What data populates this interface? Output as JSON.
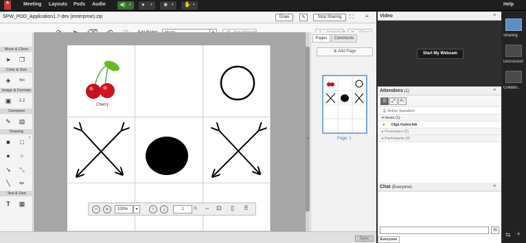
{
  "menubar": {
    "items": [
      "Meeting",
      "Layouts",
      "Pods",
      "Audio"
    ],
    "help": "Help"
  },
  "share": {
    "title": "SPW_POD_Application1.7-dev (enterprise).zip",
    "draw_label": "Draw",
    "stop_sharing_label": "Stop Sharing",
    "edit_rights_label": "Edit Rights:",
    "edit_rights_value": "Hosts",
    "not_allowed_label": "Not Allowed",
    "download_label": "Download",
    "close_label": "Close",
    "sections": [
      "Move & Clone",
      "Color & Size",
      "Image & Formats",
      "Comment",
      "Drawing",
      "Text & Grid"
    ],
    "size_label": "4px",
    "cherry_label": "Cherry",
    "zoom_value": "100%",
    "page_number": "1",
    "page_total": "/1",
    "sync_label": "Sync"
  },
  "pages_panel": {
    "tabs": [
      "Pages",
      "Comments"
    ],
    "add_page_label": "Add Page",
    "page_label": "Page: 1"
  },
  "video": {
    "title": "Video",
    "webcam_label": "Start My Webcam"
  },
  "attendees": {
    "title": "Attendees",
    "count": "(1)",
    "active_speakers": "Active Speakers",
    "hosts": "Hosts (1)",
    "host_name": "Olga Kalinchik",
    "presenters": "Presenters (0)",
    "participants": "Participants (0)"
  },
  "chat": {
    "title": "Chat",
    "scope": "(Everyone)",
    "tab_label": "Everyone"
  },
  "layouts": {
    "items": [
      "Sharing",
      "Discussion",
      "Collabo..."
    ]
  },
  "colors": {
    "accent": "#3a7bd5",
    "menubar": "#1e1e1e",
    "selected_layout": "#5b8ec4"
  }
}
